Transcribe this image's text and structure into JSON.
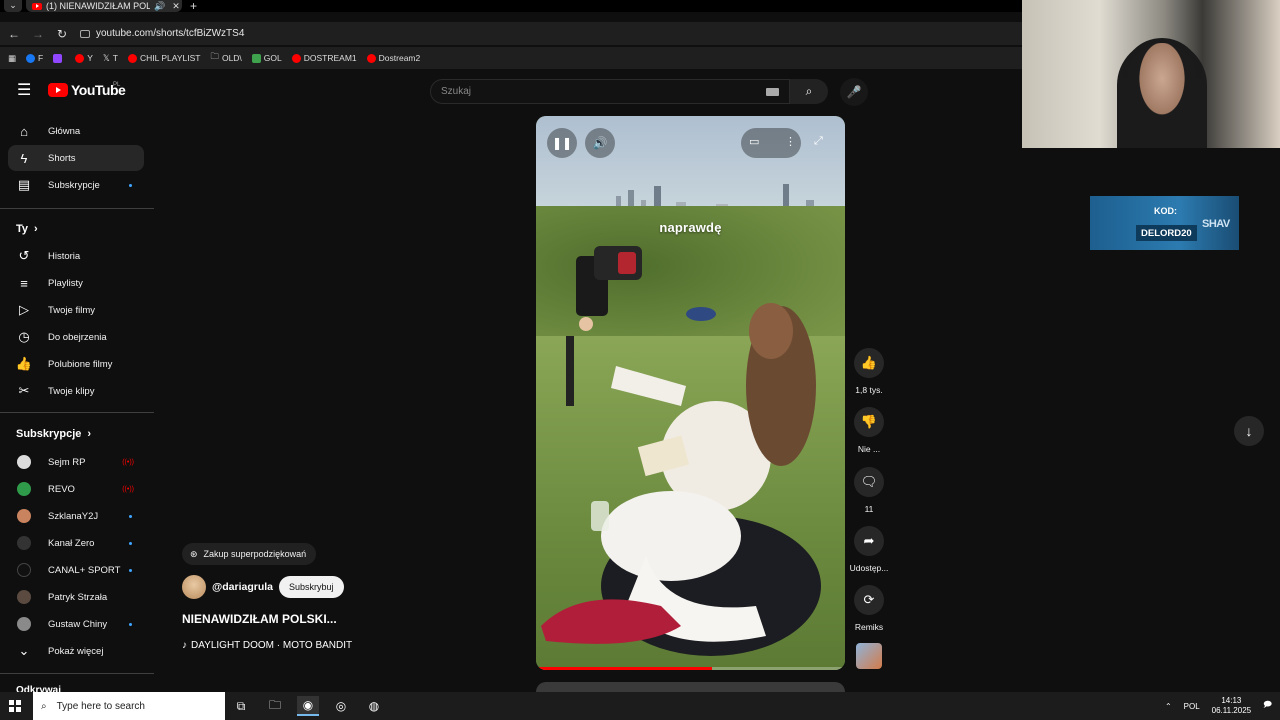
{
  "browser": {
    "tab_title": "(1) NIENAWIDZIŁAM POLSKI...",
    "url": "youtube.com/shorts/tcfBiZWzTS4",
    "bookmarks": [
      "F",
      "",
      "Y",
      "T",
      "CHIL PLAYLIST",
      "OLD\\",
      "GOL",
      "DOSTREAM1",
      "Dostream2"
    ]
  },
  "youtube": {
    "logo": "YouTube",
    "logo_region": "PL",
    "search_placeholder": "Szukaj",
    "nav": {
      "home": "Główna",
      "shorts": "Shorts",
      "subscriptions": "Subskrypcje"
    },
    "you_section": "Ty",
    "you_items": [
      "Historia",
      "Playlisty",
      "Twoje filmy",
      "Do obejrzenia",
      "Polubione filmy",
      "Twoje klipy"
    ],
    "subs_section": "Subskrypcje",
    "subs": [
      {
        "name": "Sejm RP",
        "badge": "live",
        "color": "#dcdcdc"
      },
      {
        "name": "REVO",
        "badge": "live",
        "color": "#2f9b4a"
      },
      {
        "name": "SzklanaY2J",
        "badge": "new",
        "color": "#c9835e"
      },
      {
        "name": "Kanał Zero",
        "badge": "new",
        "color": "#222222"
      },
      {
        "name": "CANAL+ SPORT",
        "badge": "new",
        "color": "#111111"
      },
      {
        "name": "Patryk Strzała",
        "badge": "",
        "color": "#5a4a40"
      },
      {
        "name": "Gustaw Chiny",
        "badge": "new",
        "color": "#8a8a8a"
      }
    ],
    "show_more": "Pokaż więcej",
    "explore_partial": "Odkrywaj"
  },
  "short": {
    "overlay_word": "naprawdę",
    "progress": 0.57,
    "super_thanks": "Zakup superpodziękowań",
    "channel": "@dariagrula",
    "subscribe": "Subskrybuj",
    "title": "NIENAWIDZIŁAM POLSKI...",
    "music": "DAYLIGHT DOOM · MOTO BANDIT",
    "likes": "1,8 tys.",
    "dislike": "Nie ...",
    "comments": "11",
    "share": "Udostęp...",
    "remix": "Remiks"
  },
  "promo": {
    "label": "KOD:",
    "code": "DELORD20",
    "brand": "SHAV"
  },
  "taskbar": {
    "search_placeholder": "Type here to search",
    "lang": "POL",
    "time": "14:13",
    "date": "06.11.2025"
  }
}
